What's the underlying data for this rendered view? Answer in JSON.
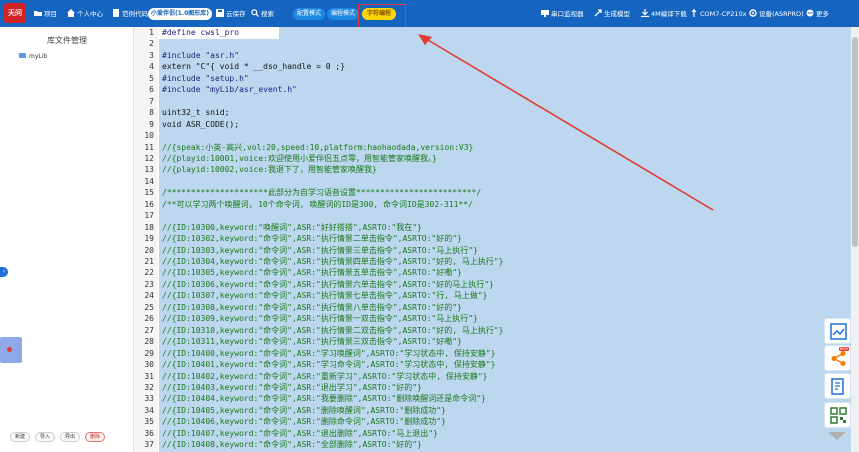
{
  "app": {
    "logo_text": "天问"
  },
  "toolbar": {
    "items": [
      {
        "label": "项目",
        "icon": "folder-icon"
      },
      {
        "label": "个人中心",
        "icon": "home-icon"
      },
      {
        "label": "范例代码",
        "icon": "book-icon"
      }
    ],
    "board_select": "小爱伴侣(1.0图形库)",
    "save_label": "云保存",
    "search_label": "搜索",
    "modes": [
      "配置模式",
      "编程模式",
      "字符编程"
    ],
    "active_mode_index": 2,
    "right_items": [
      {
        "label": "串口监视器",
        "icon": "monitor-icon"
      },
      {
        "label": "生成模型",
        "icon": "settings-icon"
      },
      {
        "label": "4M编译下载",
        "icon": "download-icon"
      },
      {
        "label": "COM7-CP210x",
        "icon": "usb-icon"
      },
      {
        "label": "设备(ASRPRO)",
        "icon": "gear-icon"
      },
      {
        "label": "更多",
        "icon": "more-icon"
      }
    ]
  },
  "sidebar": {
    "title": "库文件管理",
    "items": [
      {
        "label": "myLib"
      }
    ],
    "buttons": [
      "新建",
      "导入",
      "导出",
      "删除"
    ]
  },
  "editor": {
    "lines": [
      "#define cwsl_pro",
      "",
      "#include \"asr.h\"",
      "extern \"C\"{ void * __dso_handle = 0 ;}",
      "#include \"setup.h\"",
      "#include \"myLib/asr_event.h\"",
      "",
      "uint32_t snid;",
      "void ASR_CODE();",
      "",
      "//{speak:小英-高兴,vol:20,speed:10,platform:haohaodada,version:V3}",
      "//{playid:10001,voice:欢迎使用小爱伴侣五点零，用智能管家唤醒我。}",
      "//{playid:10002,voice:我退下了，用智能管家唤醒我}",
      "",
      "/*********************此部分为自学习语音设置*************************/",
      "/**可以学习两个唤醒词, 10个命令词, 唤醒词的ID是300, 命令词ID是302-311**/",
      "",
      "//{ID:10300,keyword:\"唤醒词\",ASR:\"好好搭搭\",ASRTO:\"我在\"}",
      "//{ID:10302,keyword:\"命令词\",ASR:\"执行情景二单击指令\",ASRTO:\"好的\"}",
      "//{ID:10303,keyword:\"命令词\",ASR:\"执行情景三单击指令\",ASRTO:\"马上执行\"}",
      "//{ID:10304,keyword:\"命令词\",ASR:\"执行情景四单击指令\",ASRTO:\"好的, 马上执行\"}",
      "//{ID:10305,keyword:\"命令词\",ASR:\"执行情景五单击指令\",ASRTO:\"好嘞\"}",
      "//{ID:10306,keyword:\"命令词\",ASR:\"执行情景六单击指令\",ASRTO:\"好的马上执行\"}",
      "//{ID:10307,keyword:\"命令词\",ASR:\"执行情景七单击指令\",ASRTO:\"行, 马上做\"}",
      "//{ID:10308,keyword:\"命令词\",ASR:\"执行情景八单击指令\",ASRTO:\"好的\"}",
      "//{ID:10309,keyword:\"命令词\",ASR:\"执行情景一双击指令\",ASRTO:\"马上执行\"}",
      "//{ID:10310,keyword:\"命令词\",ASR:\"执行情景二双击指令\",ASRTO:\"好的, 马上执行\"}",
      "//{ID:10311,keyword:\"命令词\",ASR:\"执行情景三双击指令\",ASRTO:\"好嘞\"}",
      "//{ID:10400,keyword:\"命令词\",ASR:\"学习唤醒词\",ASRTO:\"学习状态中, 保持安静\"}",
      "//{ID:10401,keyword:\"命令词\",ASR:\"学习命令词\",ASRTO:\"学习状态中, 保持安静\"}",
      "//{ID:10402,keyword:\"命令词\",ASR:\"重新学习\",ASRTO:\"学习状态中, 保持安静\"}",
      "//{ID:10403,keyword:\"命令词\",ASR:\"退出学习\",ASRTO:\"好的\"}",
      "//{ID:10404,keyword:\"命令词\",ASR:\"我要删除\",ASRTO:\"删除唤醒词还是命令词\"}",
      "//{ID:10405,keyword:\"命令词\",ASR:\"删除唤醒词\",ASRTO:\"删除成功\"}",
      "//{ID:10406,keyword:\"命令词\",ASR:\"删除命令词\",ASRTO:\"删除成功\"}",
      "//{ID:10407,keyword:\"命令词\",ASR:\"退出删除\",ASRTO:\"马上退出\"}",
      "//{ID:10408,keyword:\"命令词\",ASR:\"全部删除\",ASRTO:\"好的\"}"
    ]
  },
  "right_tools": [
    {
      "icon": "chart-icon"
    },
    {
      "icon": "share-icon",
      "badge": "NEW"
    },
    {
      "icon": "edit-icon"
    },
    {
      "icon": "qrcode-icon"
    }
  ]
}
